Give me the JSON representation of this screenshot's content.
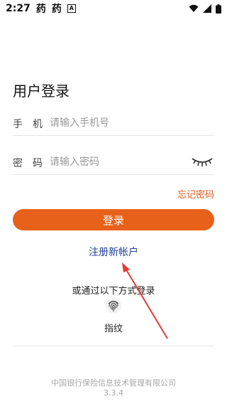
{
  "status_bar": {
    "time": "2:27",
    "app_icon_1": "药",
    "app_icon_2": "药",
    "notification_letter": "A"
  },
  "login": {
    "title": "用户登录",
    "phone_label": "手机",
    "phone_placeholder": "请输入手机号",
    "password_label": "密码",
    "password_placeholder": "请输入密码",
    "forgot_password": "忘记密码",
    "login_button": "登录",
    "register_link": "注册新帐户"
  },
  "alternate_login": {
    "title": "或通过以下方式登录",
    "fingerprint_label": "指纹"
  },
  "footer": {
    "company": "中国银行保险信息技术管理有限公司",
    "version": "3.3.4"
  },
  "colors": {
    "accent": "#e8611a",
    "link": "#1f3f9a",
    "annotation_arrow": "#e53935"
  }
}
